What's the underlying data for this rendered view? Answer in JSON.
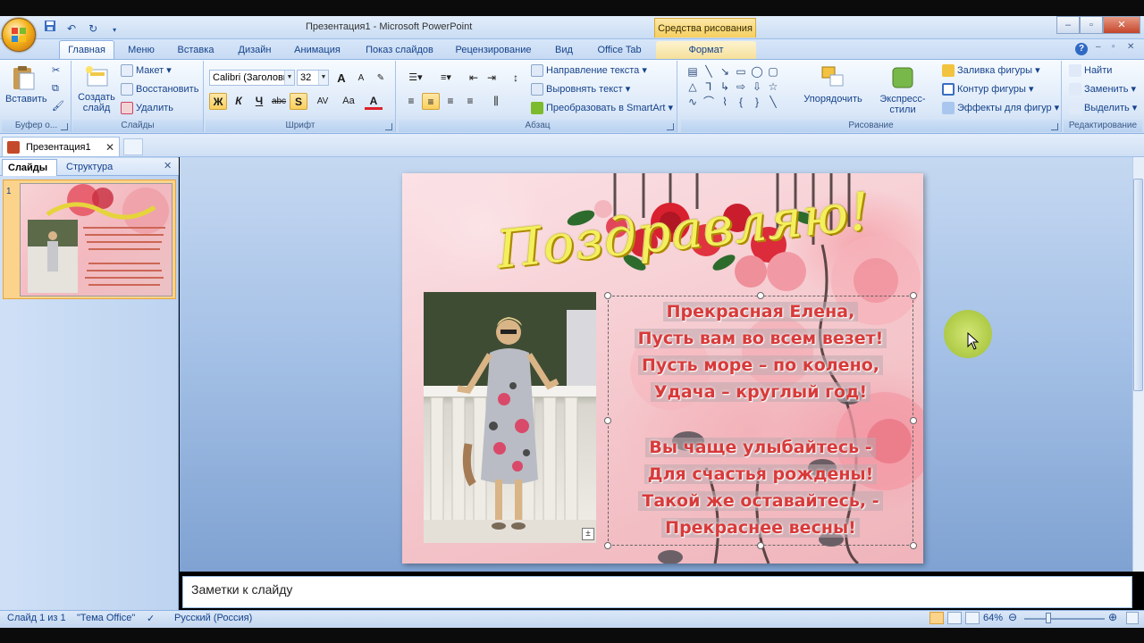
{
  "window": {
    "title": "Презентация1 - Microsoft PowerPoint",
    "context_tab_title": "Средства рисования"
  },
  "tabs": [
    "Главная",
    "Меню",
    "Вставка",
    "Дизайн",
    "Анимация",
    "Показ слайдов",
    "Рецензирование",
    "Вид",
    "Office Tab",
    "Формат"
  ],
  "ribbon": {
    "clipboard": {
      "paste": "Вставить",
      "label": "Буфер о..."
    },
    "slides": {
      "create": "Создать слайд",
      "layout": "Макет",
      "reset": "Восстановить",
      "delete": "Удалить",
      "label": "Слайды"
    },
    "font": {
      "name": "Calibri (Заголовк",
      "size": "32",
      "label": "Шрифт",
      "bold": "Ж",
      "italic": "К",
      "underline": "Ч",
      "strike": "abc",
      "shadow": "S",
      "spacing": "AV",
      "case": "Aa",
      "grow": "A",
      "shrink": "A",
      "color": "A"
    },
    "paragraph": {
      "direction": "Направление текста",
      "align": "Выровнять текст",
      "smartart": "Преобразовать в SmartArt",
      "label": "Абзац"
    },
    "drawing": {
      "arrange": "Упорядочить",
      "quick_styles": "Экспресс-стили",
      "fill": "Заливка фигуры",
      "outline": "Контур фигуры",
      "effects": "Эффекты для фигур",
      "label": "Рисование"
    },
    "editing": {
      "find": "Найти",
      "replace": "Заменить",
      "select": "Выделить",
      "label": "Редактирование"
    }
  },
  "document": {
    "tab": "Презентация1"
  },
  "left_pane": {
    "tab_slides": "Слайды",
    "tab_outline": "Структура",
    "slide_number": "1"
  },
  "slide": {
    "title": "Поздравляю!",
    "stanza1": [
      "Прекрасная Елена,",
      "Пусть вам во всем везет!",
      "Пусть море – по колено,",
      "Удача – круглый год!"
    ],
    "stanza2": [
      "Вы чаще улыбайтесь -",
      "Для счастья рождены!",
      "Такой же оставайтесь, -",
      "Прекраснее весны!"
    ]
  },
  "notes": {
    "placeholder": "Заметки к слайду"
  },
  "status": {
    "slide": "Слайд 1 из 1",
    "theme": "\"Тема Office\"",
    "language": "Русский (Россия)",
    "zoom": "64%"
  },
  "colors": {
    "ribbon_bg": "#dbe8f8",
    "accent": "#15428b",
    "poem": "#d83a3a",
    "title_gold": "#f4ef5c"
  }
}
